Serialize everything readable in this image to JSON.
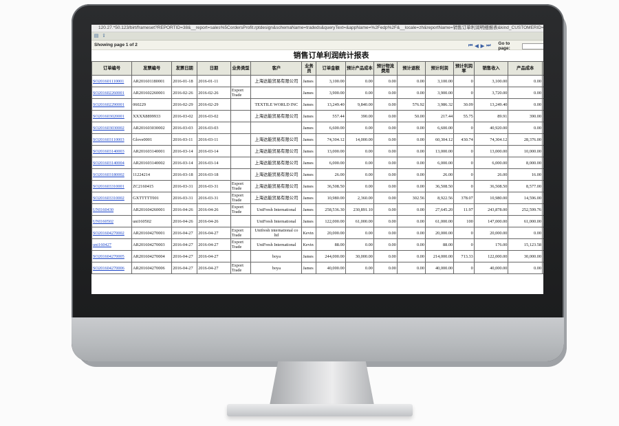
{
  "browser": {
    "url": "120.27.*50.123/birt/frameset?REPORTID=38&__report=sales%5CordersProfit.rptdesign&schemaName=tradeds&queryText=&appName=%2Fedp%2F&__locale=zh&reportName=销售订单利润明细报表&kind_CUSTOMERID=&CUSTOMERID=&SON..."
  },
  "pager": {
    "showing": "Showing page 1 of 2",
    "goto_label": "Go to page:"
  },
  "report": {
    "title": "销售订单利润统计报表",
    "columns": [
      "订单编号",
      "发票编号",
      "发票日期",
      "日期",
      "业务类型",
      "客户",
      "业务员",
      "订单金额",
      "预计产品成本",
      "预计物流费用",
      "预计退税",
      "预计利润",
      "预计利润率",
      "销售收入",
      "产品成本",
      "费用成本"
    ],
    "rows": [
      [
        "SO201601110001",
        "AR201601180001",
        "2016-01-18",
        "2016-01-11",
        "",
        "上海达能贸易有限公司",
        "James",
        "3,100.00",
        "0.00",
        "0.00",
        "0.00",
        "3,100.00",
        "0",
        "3,100.00",
        "0.00",
        ""
      ],
      [
        "SO201602260001",
        "AR201602260001",
        "2016-02-26",
        "2016-02-26",
        "Export Trade",
        "",
        "James",
        "3,900.00",
        "0.00",
        "0.00",
        "0.00",
        "3,900.00",
        "0",
        "3,720.00",
        "0.00",
        ""
      ],
      [
        "SO201602290001",
        "060229",
        "2016-02-29",
        "2016-02-29",
        "",
        "TEXTILE WORLD INC",
        "James",
        "13,249.40",
        "9,840.00",
        "0.00",
        "576.92",
        "3,986.32",
        "30.09",
        "13,249.40",
        "0.00",
        ""
      ],
      [
        "SO201603020001",
        "XXXX8899933",
        "2016-03-02",
        "2016-03-02",
        "",
        "上海达能贸易有限公司",
        "James",
        "557.44",
        "390.00",
        "0.00",
        "50.00",
        "217.44",
        "55.75",
        "89.91",
        "390.00",
        "12"
      ],
      [
        "SO201603030002",
        "AR201603030002",
        "2016-03-03",
        "2016-03-03",
        "",
        "",
        "James",
        "6,600.00",
        "0.00",
        "0.00",
        "0.00",
        "6,600.00",
        "0",
        "40,920.00",
        "0.00",
        ""
      ],
      [
        "SO201603110003",
        "Glove0001",
        "2016-03-11",
        "2016-03-11",
        "",
        "上海达能贸易有限公司",
        "James",
        "74,304.12",
        "14,000.00",
        "0.00",
        "0.00",
        "60,304.12",
        "430.74",
        "74,304.12",
        "28,376.00",
        ""
      ],
      [
        "SO201603140003",
        "AR201603140001",
        "2016-03-14",
        "2016-03-14",
        "",
        "上海达能贸易有限公司",
        "James",
        "13,000.00",
        "0.00",
        "0.00",
        "0.00",
        "13,000.00",
        "0",
        "13,000.00",
        "10,000.00",
        ""
      ],
      [
        "SO201603140004",
        "AR201603140002",
        "2016-03-14",
        "2016-03-14",
        "",
        "上海达能贸易有限公司",
        "James",
        "6,000.00",
        "0.00",
        "0.00",
        "0.00",
        "6,000.00",
        "0",
        "6,000.00",
        "8,000.00",
        ""
      ],
      [
        "SO201603180002",
        "11224214",
        "2016-03-18",
        "2016-03-18",
        "",
        "上海达能贸易有限公司",
        "James",
        "26.00",
        "0.00",
        "0.00",
        "0.00",
        "26.00",
        "0",
        "26.00",
        "16.00",
        ""
      ],
      [
        "SO201603310001",
        "ZC2160415",
        "2016-03-31",
        "2016-03-31",
        "Export Trade",
        "上海达能贸易有限公司",
        "James",
        "36,508.50",
        "0.00",
        "0.00",
        "0.00",
        "36,508.50",
        "0",
        "36,508.50",
        "8,577.00",
        ""
      ],
      [
        "SO201603310002",
        "GXTTTTT001",
        "2016-03-31",
        "2016-03-31",
        "Export Trade",
        "上海达能贸易有限公司",
        "James",
        "10,980.00",
        "2,360.00",
        "0.00",
        "302.56",
        "8,922.56",
        "378.07",
        "10,980.00",
        "14,596.00",
        ""
      ],
      [
        "UNI160430",
        "AR201604260001",
        "2016-04-26",
        "2016-04-26",
        "Export Trade",
        "UniFresh International",
        "James",
        "258,536.30",
        "230,891.10",
        "0.00",
        "0.00",
        "27,645.20",
        "11.97",
        "243,878.00",
        "252,599.76",
        "1,00"
      ],
      [
        "UNI160502",
        "uni160502",
        "2016-04-26",
        "2016-04-26",
        "",
        "UniFresh International",
        "James",
        "122,000.00",
        "61,000.00",
        "0.00",
        "0.00",
        "61,000.00",
        "100",
        "147,000.00",
        "61,000.00",
        ""
      ],
      [
        "SO201604270002",
        "AR201604270001",
        "2016-04-27",
        "2016-04-27",
        "Export Trade",
        "Unifresh international co ltd",
        "Kevin",
        "20,000.00",
        "0.00",
        "0.00",
        "0.00",
        "20,000.00",
        "0",
        "20,000.00",
        "0.00",
        ""
      ],
      [
        "uni160427",
        "AR201604270003",
        "2016-04-27",
        "2016-04-27",
        "Export Trade",
        "UniFresh International",
        "Kevin",
        "88.00",
        "0.00",
        "0.00",
        "0.00",
        "88.00",
        "0",
        "176.00",
        "15,123.58",
        "19"
      ],
      [
        "SO201604270005",
        "AR201604270004",
        "2016-04-27",
        "2016-04-27",
        "",
        "boya",
        "James",
        "244,000.00",
        "30,000.00",
        "0.00",
        "0.00",
        "214,000.00",
        "713.33",
        "122,000.00",
        "30,000.00",
        ""
      ],
      [
        "SO201604270006",
        "AR201604270006",
        "2016-04-27",
        "2016-04-27",
        "Export Trade",
        "boya",
        "James",
        "40,000.00",
        "0.00",
        "0.00",
        "0.00",
        "40,000.00",
        "0",
        "40,000.00",
        "0.00",
        ""
      ]
    ]
  }
}
